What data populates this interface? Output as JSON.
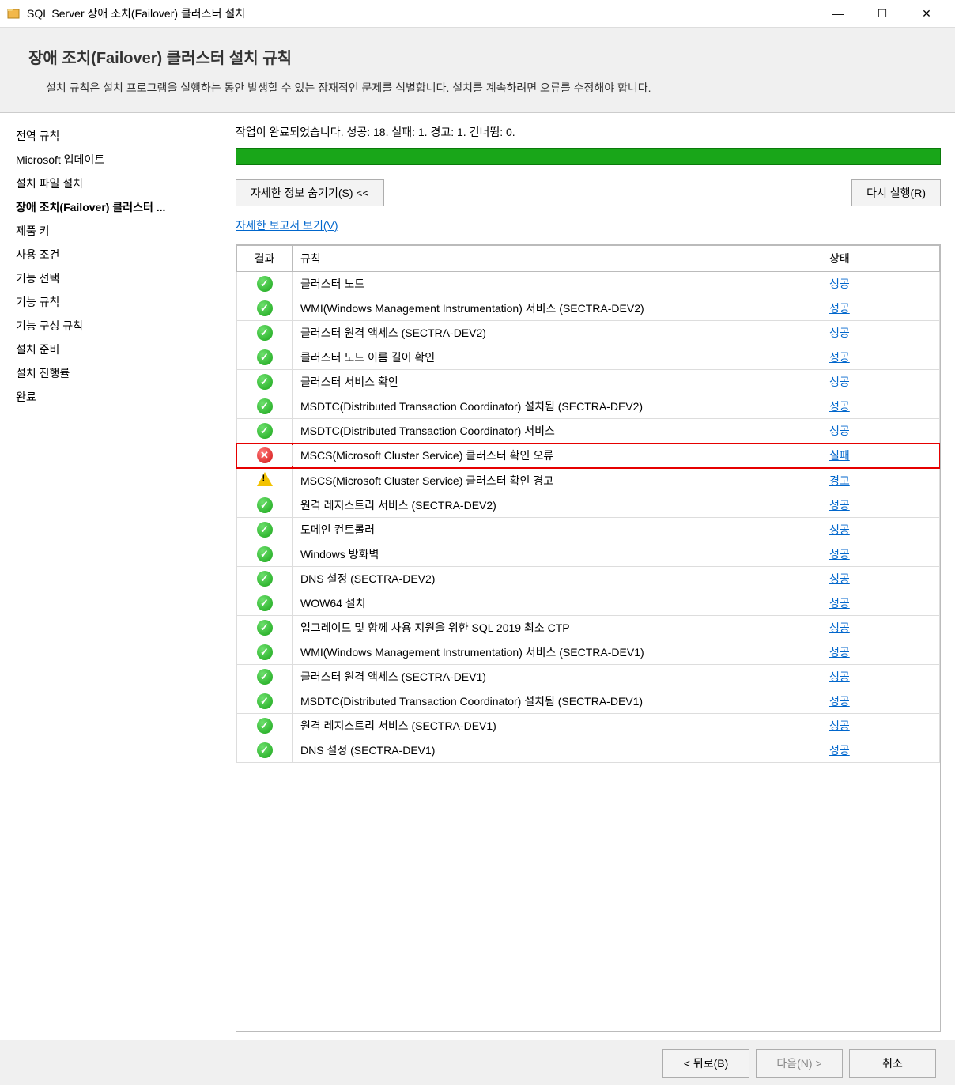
{
  "window": {
    "title": "SQL Server 장애 조치(Failover) 클러스터 설치"
  },
  "header": {
    "title": "장애 조치(Failover) 클러스터 설치 규칙",
    "description": "설치 규칙은 설치 프로그램을 실행하는 동안 발생할 수 있는 잠재적인 문제를 식별합니다. 설치를 계속하려면 오류를 수정해야 합니다."
  },
  "sidebar": {
    "items": [
      {
        "label": "전역 규칙",
        "active": false
      },
      {
        "label": "Microsoft 업데이트",
        "active": false
      },
      {
        "label": "설치 파일 설치",
        "active": false
      },
      {
        "label": "장애 조치(Failover) 클러스터 ...",
        "active": true
      },
      {
        "label": "제품 키",
        "active": false
      },
      {
        "label": "사용 조건",
        "active": false
      },
      {
        "label": "기능 선택",
        "active": false
      },
      {
        "label": "기능 규칙",
        "active": false
      },
      {
        "label": "기능 구성 규칙",
        "active": false
      },
      {
        "label": "설치 준비",
        "active": false
      },
      {
        "label": "설치 진행률",
        "active": false
      },
      {
        "label": "완료",
        "active": false
      }
    ]
  },
  "main": {
    "status_line": "작업이 완료되었습니다. 성공: 18. 실패: 1. 경고: 1. 건너뜀: 0.",
    "hide_details_label": "자세한 정보 숨기기(S) <<",
    "rerun_label": "다시 실행(R)",
    "report_link": "자세한 보고서 보기(V)",
    "columns": {
      "result": "결과",
      "rule": "규칙",
      "status": "상태"
    },
    "rows": [
      {
        "icon": "success",
        "rule": "클러스터 노드",
        "status": "성공",
        "highlight": false
      },
      {
        "icon": "success",
        "rule": "WMI(Windows Management Instrumentation) 서비스 (SECTRA-DEV2)",
        "status": "성공",
        "highlight": false
      },
      {
        "icon": "success",
        "rule": "클러스터 원격 액세스 (SECTRA-DEV2)",
        "status": "성공",
        "highlight": false
      },
      {
        "icon": "success",
        "rule": "클러스터 노드 이름 길이 확인",
        "status": "성공",
        "highlight": false
      },
      {
        "icon": "success",
        "rule": "클러스터 서비스 확인",
        "status": "성공",
        "highlight": false
      },
      {
        "icon": "success",
        "rule": "MSDTC(Distributed Transaction Coordinator) 설치됨 (SECTRA-DEV2)",
        "status": "성공",
        "highlight": false
      },
      {
        "icon": "success",
        "rule": "MSDTC(Distributed Transaction Coordinator) 서비스",
        "status": "성공",
        "highlight": false
      },
      {
        "icon": "error",
        "rule": "MSCS(Microsoft Cluster Service) 클러스터 확인 오류",
        "status": "실패",
        "highlight": true
      },
      {
        "icon": "warning",
        "rule": "MSCS(Microsoft Cluster Service) 클러스터 확인 경고",
        "status": "경고",
        "highlight": false
      },
      {
        "icon": "success",
        "rule": "원격 레지스트리 서비스 (SECTRA-DEV2)",
        "status": "성공",
        "highlight": false
      },
      {
        "icon": "success",
        "rule": "도메인 컨트롤러",
        "status": "성공",
        "highlight": false
      },
      {
        "icon": "success",
        "rule": "Windows 방화벽",
        "status": "성공",
        "highlight": false
      },
      {
        "icon": "success",
        "rule": "DNS 설정 (SECTRA-DEV2)",
        "status": "성공",
        "highlight": false
      },
      {
        "icon": "success",
        "rule": "WOW64 설치",
        "status": "성공",
        "highlight": false
      },
      {
        "icon": "success",
        "rule": "업그레이드 및 함께 사용 지원을 위한 SQL 2019 최소 CTP",
        "status": "성공",
        "highlight": false
      },
      {
        "icon": "success",
        "rule": "WMI(Windows Management Instrumentation) 서비스 (SECTRA-DEV1)",
        "status": "성공",
        "highlight": false
      },
      {
        "icon": "success",
        "rule": "클러스터 원격 액세스 (SECTRA-DEV1)",
        "status": "성공",
        "highlight": false
      },
      {
        "icon": "success",
        "rule": "MSDTC(Distributed Transaction Coordinator) 설치됨 (SECTRA-DEV1)",
        "status": "성공",
        "highlight": false
      },
      {
        "icon": "success",
        "rule": "원격 레지스트리 서비스 (SECTRA-DEV1)",
        "status": "성공",
        "highlight": false
      },
      {
        "icon": "success",
        "rule": "DNS 설정 (SECTRA-DEV1)",
        "status": "성공",
        "highlight": false
      }
    ]
  },
  "footer": {
    "back": "< 뒤로(B)",
    "next": "다음(N) >",
    "cancel": "취소"
  }
}
